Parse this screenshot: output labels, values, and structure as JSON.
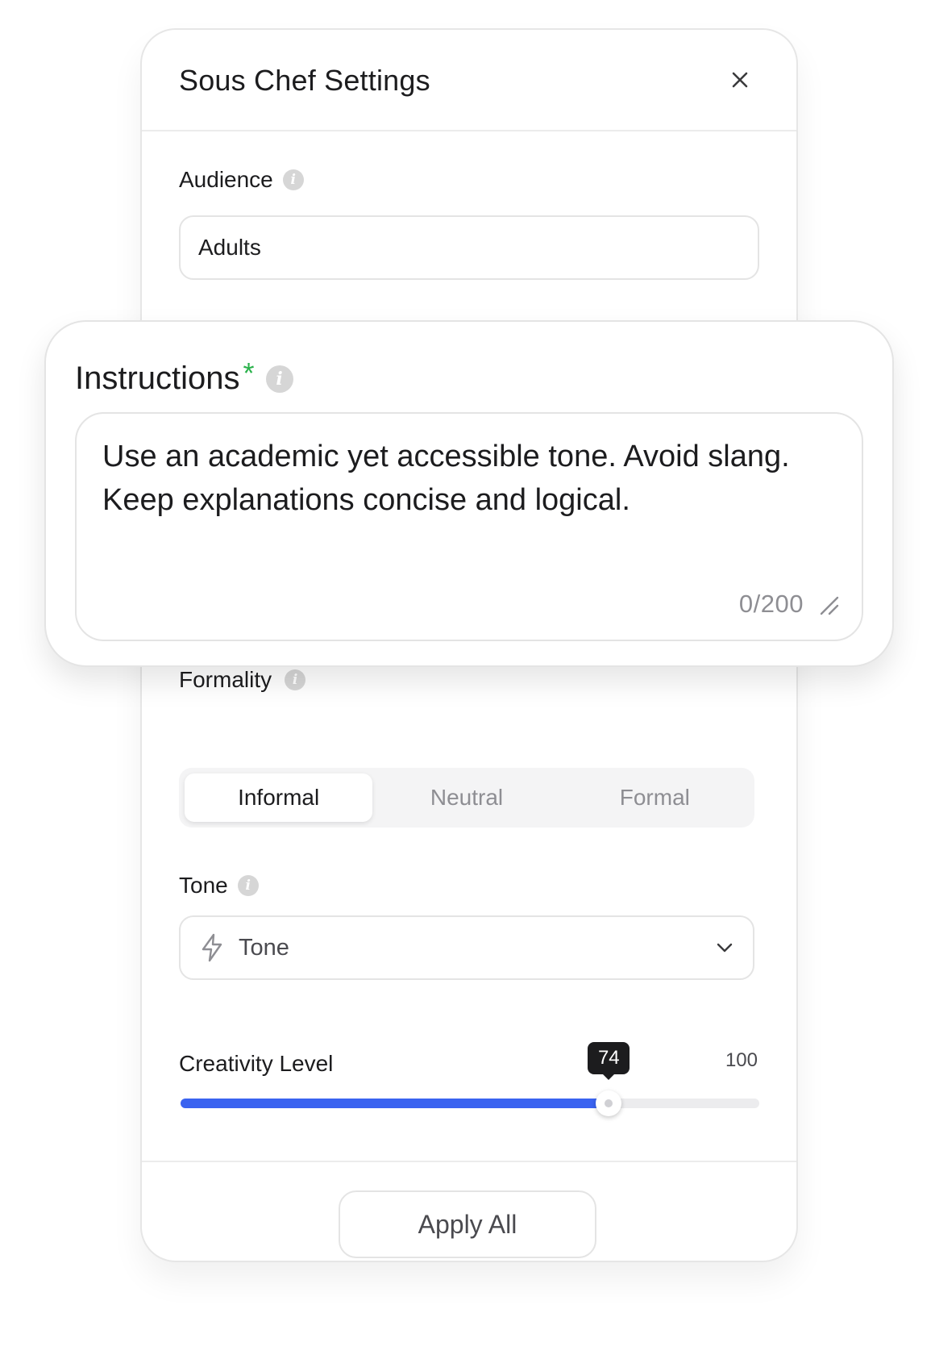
{
  "dialog": {
    "title": "Sous Chef Settings"
  },
  "audience": {
    "label": "Audience",
    "value": "Adults"
  },
  "instructions": {
    "label": "Instructions",
    "required_marker": "*",
    "value": "Use an academic yet accessible tone. Avoid slang. Keep explanations concise and logical.",
    "counter": "0/200"
  },
  "formality": {
    "label": "Formality",
    "options": [
      "Informal",
      "Neutral",
      "Formal"
    ],
    "selected": "Informal"
  },
  "tone": {
    "label": "Tone",
    "value": "Tone"
  },
  "creativity": {
    "label": "Creativity Level",
    "value": "74",
    "max": "100",
    "fraction": 0.74
  },
  "footer": {
    "apply_label": "Apply All"
  },
  "colors": {
    "accent": "#3a63f0",
    "required": "#2bb24c"
  }
}
